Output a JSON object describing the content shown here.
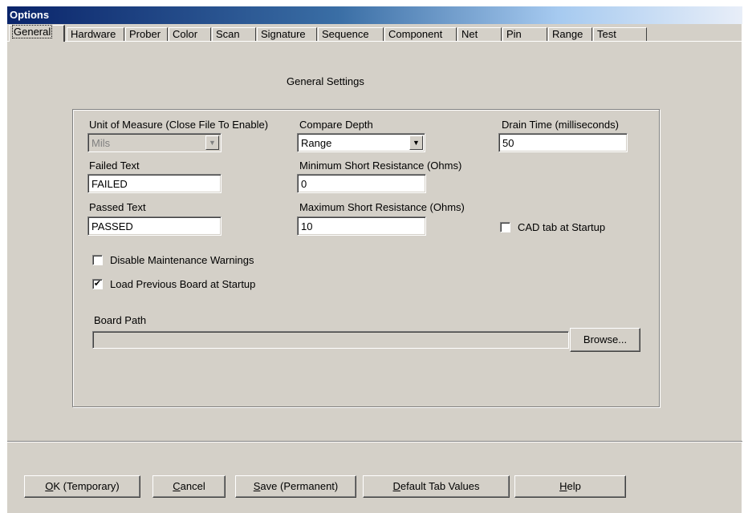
{
  "window": {
    "title": "Options"
  },
  "tabs": [
    "General",
    "Hardware",
    "Prober",
    "Color",
    "Scan",
    "Signature",
    "Sequence",
    "Component",
    "Net",
    "Pin",
    "Range",
    "Test"
  ],
  "active_tab": "General",
  "heading": "General Settings",
  "unit": {
    "label": "Unit of Measure (Close File To Enable)",
    "value": "Mils"
  },
  "compare_depth": {
    "label": "Compare Depth",
    "value": "Range"
  },
  "drain_time": {
    "label": "Drain Time (milliseconds)",
    "value": "50"
  },
  "failed_text": {
    "label": "Failed Text",
    "value": "FAILED"
  },
  "min_short": {
    "label": "Minimum Short Resistance (Ohms)",
    "value": "0"
  },
  "passed_text": {
    "label": "Passed Text",
    "value": "PASSED"
  },
  "max_short": {
    "label": "Maximum Short Resistance (Ohms)",
    "value": "10"
  },
  "cad_tab": {
    "label": "CAD tab at Startup",
    "checked": false
  },
  "disable_maint": {
    "label": "Disable Maintenance Warnings",
    "checked": false
  },
  "load_prev": {
    "label": "Load Previous Board at Startup",
    "checked": true,
    "mark": "✔"
  },
  "board_path": {
    "label": "Board Path",
    "value": "",
    "browse": "Browse..."
  },
  "footer": {
    "ok_mnemonic": "O",
    "ok_rest": "K (Temporary)",
    "cancel_mnemonic": "C",
    "cancel_rest": "ancel",
    "save_mnemonic": "S",
    "save_rest": "ave (Permanent)",
    "default_mnemonic": "D",
    "default_rest": "efault Tab Values",
    "help_mnemonic": "H",
    "help_rest": "elp"
  },
  "colors": {
    "face": "#d4d0c8",
    "title_start": "#0a246a",
    "title_end": "#a6caf0"
  }
}
